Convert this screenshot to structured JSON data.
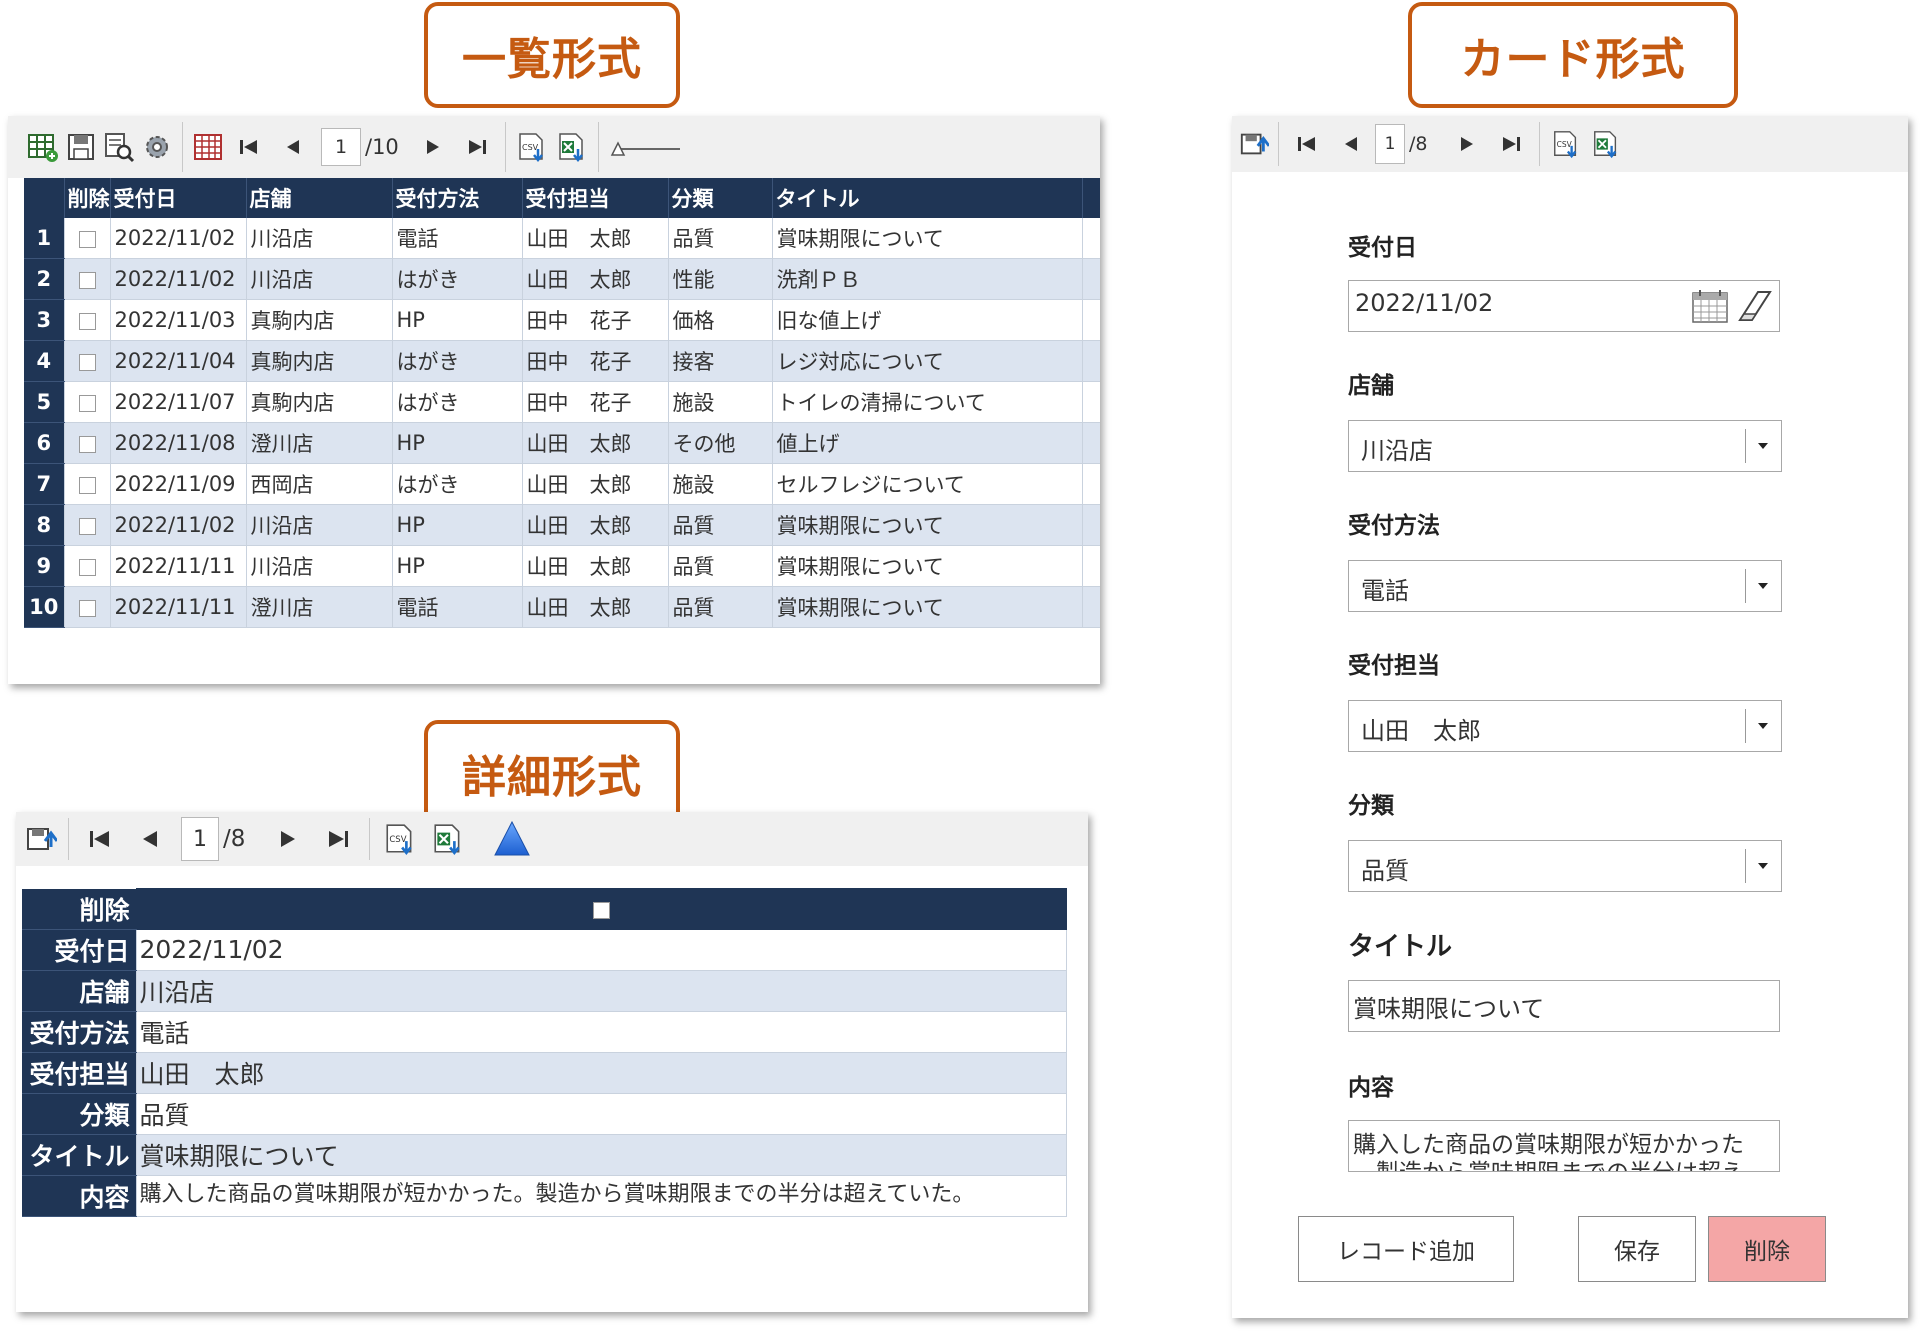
{
  "callouts": {
    "list": "一覧形式",
    "card": "カード形式",
    "detail": "詳細形式"
  },
  "list_view": {
    "pager": {
      "current": "1",
      "total": "/10"
    },
    "columns": [
      "削除",
      "受付日",
      "店舗",
      "受付方法",
      "受付担当",
      "分類",
      "タイトル"
    ],
    "rows": [
      {
        "no": "1",
        "date": "2022/11/02",
        "store": "川沿店",
        "method": "電話",
        "staff": "山田　太郎",
        "category": "品質",
        "title": "賞味期限について"
      },
      {
        "no": "2",
        "date": "2022/11/02",
        "store": "川沿店",
        "method": "はがき",
        "staff": "山田　太郎",
        "category": "性能",
        "title": "洗剤ＰＢ"
      },
      {
        "no": "3",
        "date": "2022/11/03",
        "store": "真駒内店",
        "method": "HP",
        "staff": "田中　花子",
        "category": "価格",
        "title": "旧な値上げ"
      },
      {
        "no": "4",
        "date": "2022/11/04",
        "store": "真駒内店",
        "method": "はがき",
        "staff": "田中　花子",
        "category": "接客",
        "title": "レジ対応について"
      },
      {
        "no": "5",
        "date": "2022/11/07",
        "store": "真駒内店",
        "method": "はがき",
        "staff": "田中　花子",
        "category": "施設",
        "title": "トイレの清掃について"
      },
      {
        "no": "6",
        "date": "2022/11/08",
        "store": "澄川店",
        "method": "HP",
        "staff": "山田　太郎",
        "category": "その他",
        "title": "値上げ"
      },
      {
        "no": "7",
        "date": "2022/11/09",
        "store": "西岡店",
        "method": "はがき",
        "staff": "山田　太郎",
        "category": "施設",
        "title": "セルフレジについて"
      },
      {
        "no": "8",
        "date": "2022/11/02",
        "store": "川沿店",
        "method": "HP",
        "staff": "山田　太郎",
        "category": "品質",
        "title": "賞味期限について"
      },
      {
        "no": "9",
        "date": "2022/11/11",
        "store": "川沿店",
        "method": "HP",
        "staff": "山田　太郎",
        "category": "品質",
        "title": "賞味期限について"
      },
      {
        "no": "10",
        "date": "2022/11/11",
        "store": "澄川店",
        "method": "電話",
        "staff": "山田　太郎",
        "category": "品質",
        "title": "賞味期限について"
      }
    ]
  },
  "detail_view": {
    "pager": {
      "current": "1",
      "total": "/8"
    },
    "fields": [
      {
        "label": "削除",
        "value": ""
      },
      {
        "label": "受付日",
        "value": "2022/11/02"
      },
      {
        "label": "店舗",
        "value": "川沿店"
      },
      {
        "label": "受付方法",
        "value": "電話"
      },
      {
        "label": "受付担当",
        "value": "山田　太郎"
      },
      {
        "label": "分類",
        "value": "品質"
      },
      {
        "label": "タイトル",
        "value": "賞味期限について"
      },
      {
        "label": "内容",
        "value": "購入した商品の賞味期限が短かかった。製造から賞味期限までの半分は超えていた。"
      }
    ]
  },
  "card_view": {
    "pager": {
      "current": "1",
      "total": "/8"
    },
    "date_label": "受付日",
    "date_value": "2022/11/02",
    "store_label": "店舗",
    "store_value": "川沿店",
    "method_label": "受付方法",
    "method_value": "電話",
    "staff_label": "受付担当",
    "staff_value": "山田　太郎",
    "category_label": "分類",
    "category_value": "品質",
    "title_label": "タイトル",
    "title_value": "賞味期限について",
    "content_label": "内容",
    "content_line1": "購入した商品の賞味期限が短かかった",
    "content_line2": "。製造から賞味期限までの半分は超え",
    "buttons": {
      "add": "レコード追加",
      "save": "保存",
      "delete": "削除"
    }
  },
  "colors": {
    "callout_border": "#c55a11",
    "header_navy": "#1f3555",
    "row_alt": "#dce4f0",
    "delete_button": "#f4a6a6"
  },
  "icons": [
    "grid-add-icon",
    "save-icon",
    "search-icon",
    "gear-icon",
    "table-icon",
    "first-page-icon",
    "prev-page-icon",
    "next-page-icon",
    "last-page-icon",
    "csv-export-icon",
    "excel-export-icon",
    "zoom-slider",
    "calendar-icon",
    "eraser-icon",
    "dropdown-icon",
    "collapse-triangle-icon"
  ]
}
